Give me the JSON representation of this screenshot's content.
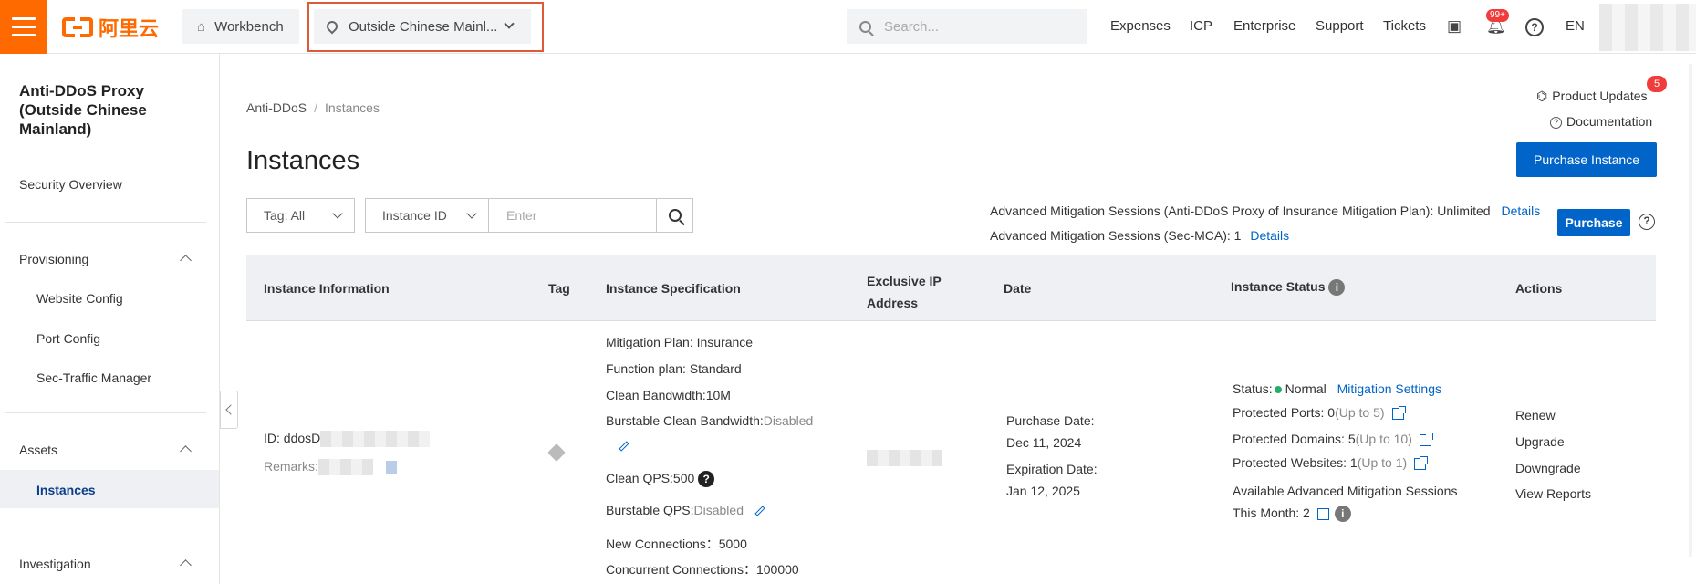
{
  "topbar": {
    "logo_text": "阿里云",
    "workbench_label": "Workbench",
    "region_label": "Outside Chinese Mainl...",
    "search_placeholder": "Search...",
    "nav": [
      "Expenses",
      "ICP",
      "Enterprise",
      "Support",
      "Tickets"
    ],
    "notification_badge": "99+",
    "lang": "EN",
    "icons": [
      "terminal-icon",
      "bell-icon",
      "help-icon"
    ]
  },
  "sidebar": {
    "title": "Anti-DDoS Proxy (Outside Chinese Mainland)",
    "security_overview": "Security Overview",
    "provisioning": "Provisioning",
    "website_config": "Website Config",
    "port_config": "Port Config",
    "sec_traffic": "Sec-Traffic Manager",
    "assets": "Assets",
    "instances": "Instances",
    "investigation": "Investigation"
  },
  "main": {
    "breadcrumb_root": "Anti-DDoS",
    "breadcrumb_sep": "/",
    "breadcrumb_current": "Instances",
    "title": "Instances",
    "product_updates": "Product Updates",
    "product_updates_badge": "5",
    "documentation": "Documentation",
    "purchase_instance": "Purchase Instance",
    "tag_filter": "Tag: All",
    "id_filter": "Instance ID",
    "input_placeholder": "Enter",
    "adv_line1": "Advanced Mitigation Sessions (Anti-DDoS Proxy of Insurance Mitigation Plan): Unlimited",
    "adv_line1_link": "Details",
    "adv_line2": "Advanced Mitigation Sessions (Sec-MCA): 1",
    "adv_line2_link": "Details",
    "purchase": "Purchase"
  },
  "table": {
    "headers": {
      "info": "Instance Information",
      "tag": "Tag",
      "spec": "Instance Specification",
      "ip": "Exclusive IP Address",
      "date": "Date",
      "status": "Instance Status",
      "actions": "Actions"
    },
    "row": {
      "id_prefix": "ID: ddosD",
      "remarks_prefix": "Remarks:",
      "spec": {
        "plan": "Mitigation Plan: Insurance",
        "function": "Function plan: Standard",
        "clean_bw": "Clean Bandwidth:10M",
        "burst_bw_label": "Burstable Clean Bandwidth:",
        "burst_bw_value": "Disabled",
        "clean_qps": "Clean QPS:500",
        "burst_qps_label": "Burstable QPS:",
        "burst_qps_value": "Disabled",
        "new_conn": "New Connections：5000",
        "concurrent": "Concurrent Connections：100000"
      },
      "date": {
        "purchase_label": "Purchase Date:",
        "purchase_value": "Dec 11, 2024",
        "expire_label": "Expiration Date:",
        "expire_value": "Jan 12, 2025"
      },
      "status": {
        "status_label": "Status:",
        "status_value": "Normal",
        "mitigation_settings": "Mitigation Settings",
        "ports_label": "Protected Ports: 0",
        "ports_limit": "(Up to 5)",
        "domains_label": "Protected Domains: 5",
        "domains_limit": "(Up to 10)",
        "websites_label": "Protected Websites: 1",
        "websites_limit": "(Up to 1)",
        "avail_label": "Available Advanced Mitigation Sessions",
        "month_label": "This Month: 2"
      },
      "actions": [
        "Renew",
        "Upgrade",
        "Downgrade",
        "View Reports"
      ]
    }
  },
  "colors": {
    "brand_orange": "#ff6a00",
    "primary_blue": "#0064c8",
    "highlight_red": "#e05a3a",
    "status_green": "#23b066"
  }
}
